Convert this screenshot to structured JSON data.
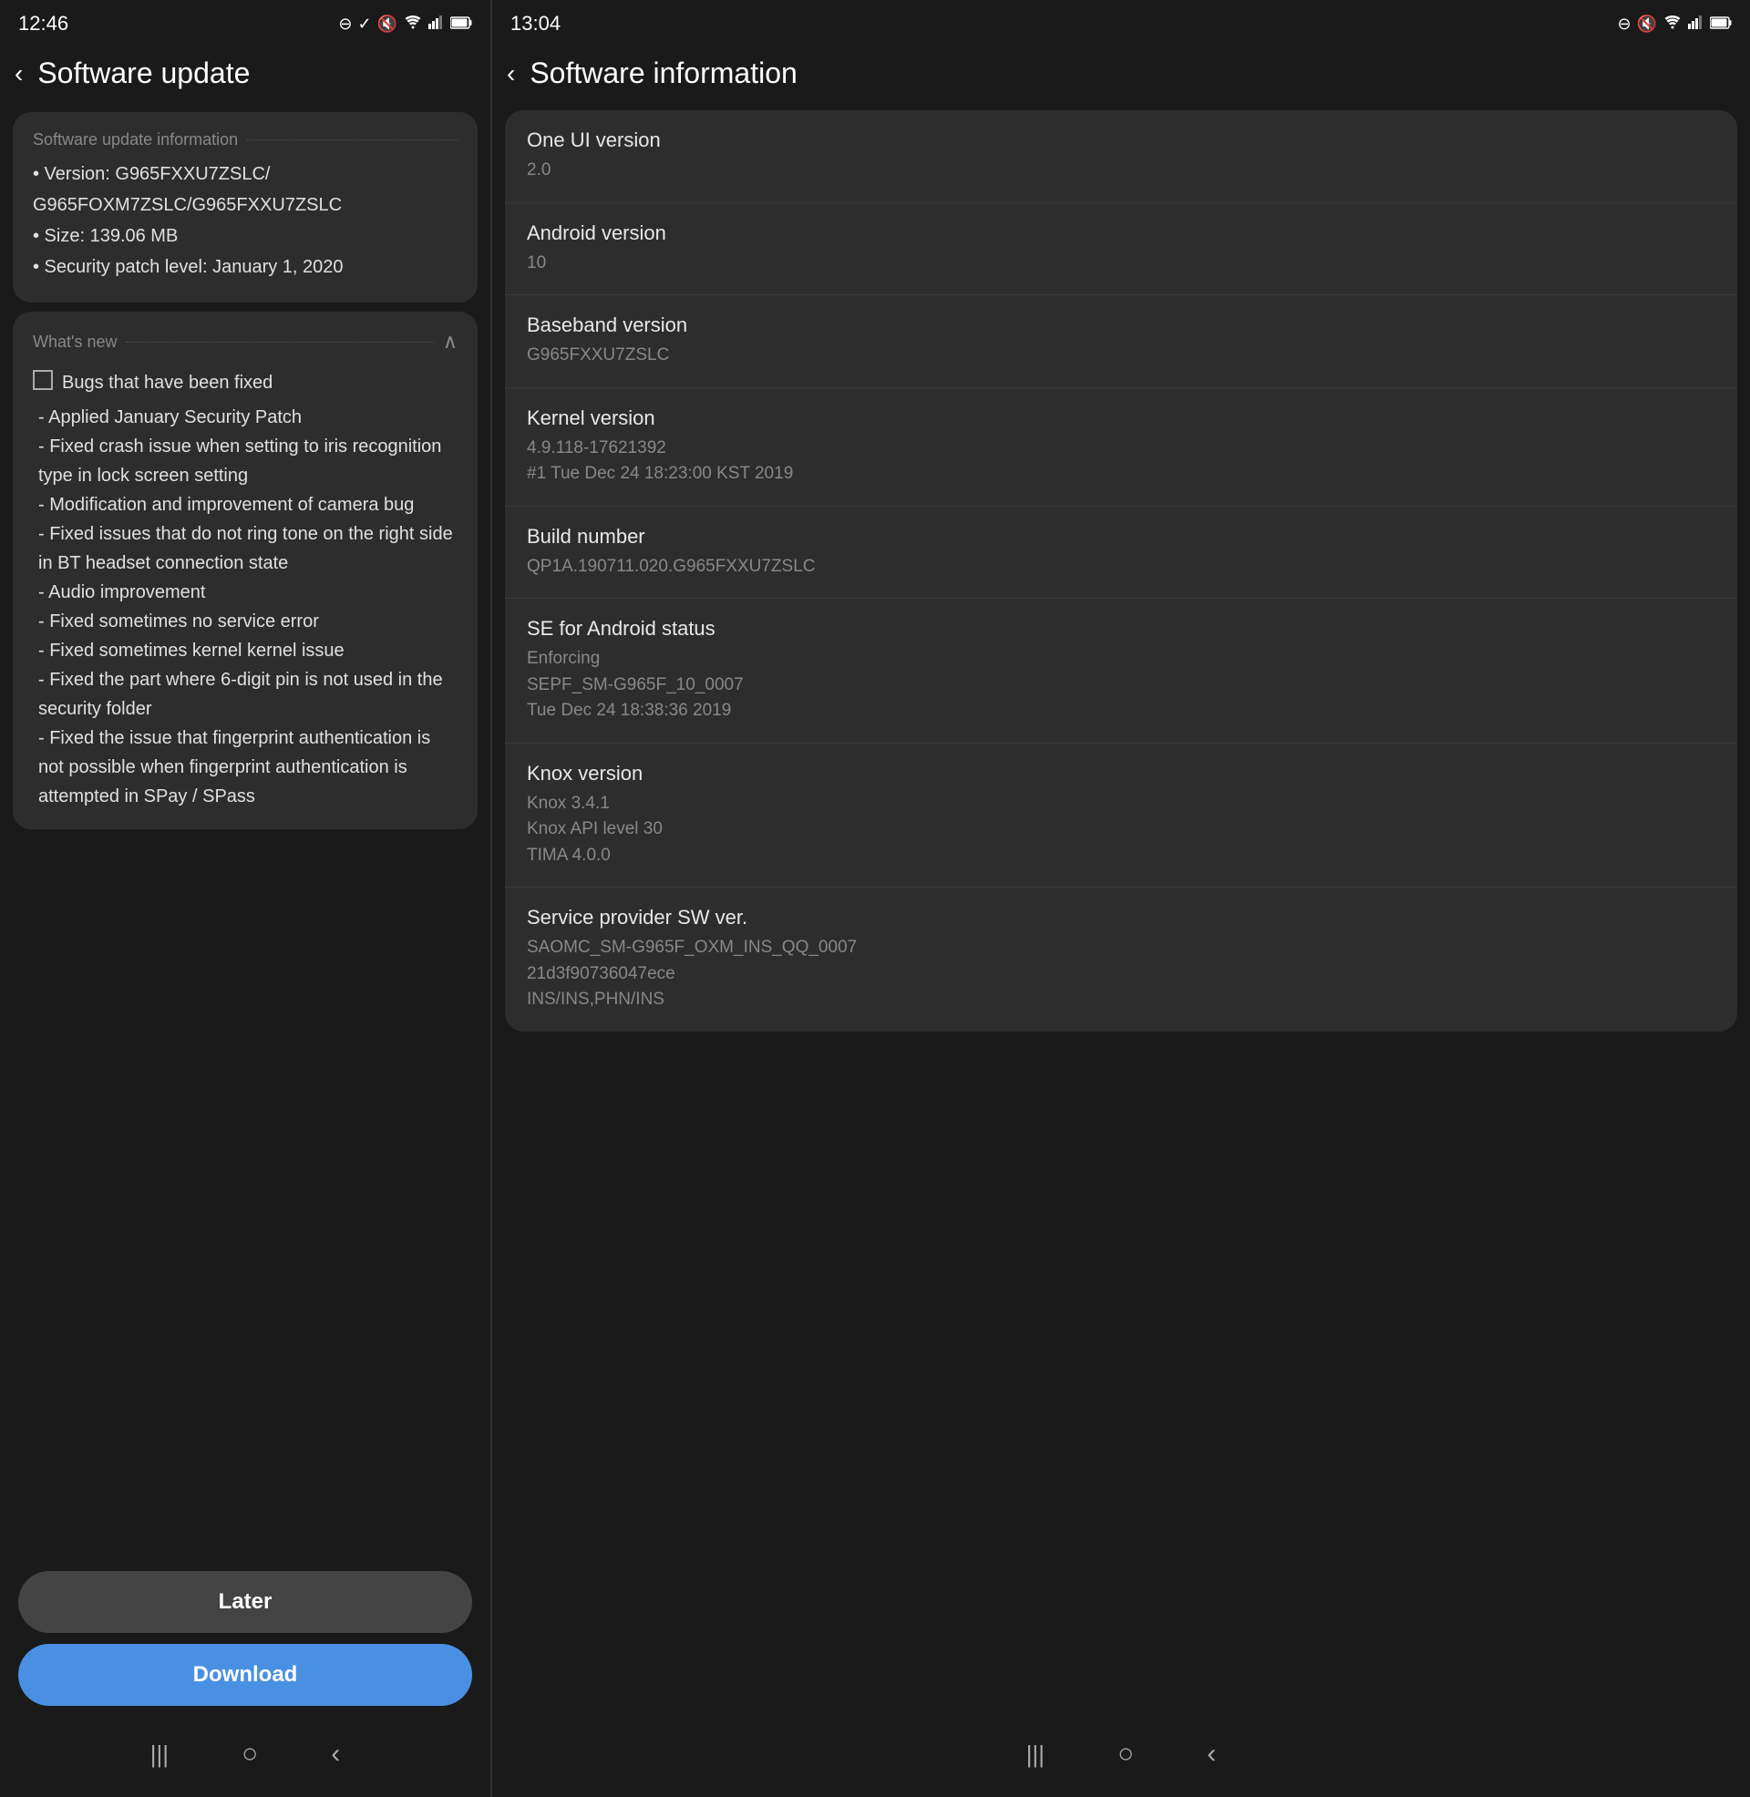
{
  "left": {
    "statusBar": {
      "time": "12:46",
      "icons": [
        "⊖",
        "✓",
        "🔇",
        "WiFi",
        "📶",
        "🔋"
      ]
    },
    "header": {
      "backArrow": "‹",
      "title": "Software update"
    },
    "updateInfo": {
      "sectionLabel": "Software update information",
      "version": "• Version: G965FXXU7ZSLC/",
      "versionCont": "  G965FOXM7ZSLC/G965FXXU7ZSLC",
      "size": "• Size: 139.06 MB",
      "securityPatch": "• Security patch level: January 1, 2020"
    },
    "whatsNew": {
      "title": "What's new",
      "checkboxLabel": "Bugs that have been fixed",
      "items": [
        "- Applied January Security Patch",
        "- Fixed crash issue when setting to iris recognition type in lock screen setting",
        "- Modification and improvement of camera bug",
        "- Fixed issues that do not ring tone on the right side in BT headset connection state",
        "- Audio improvement",
        "- Fixed sometimes no service error",
        "- Fixed sometimes kernel kernel issue",
        "- Fixed the part where 6-digit pin is not used in the security folder",
        "- Fixed the issue that fingerprint authentication is not possible when fingerprint authentication is attempted in SPay / SPass"
      ]
    },
    "buttons": {
      "later": "Later",
      "download": "Download"
    },
    "navBar": {
      "menu": "|||",
      "home": "○",
      "back": "‹"
    }
  },
  "right": {
    "statusBar": {
      "time": "13:04",
      "icons": [
        "⊖",
        "🔇",
        "WiFi",
        "📶",
        "🔋"
      ]
    },
    "header": {
      "backArrow": "‹",
      "title": "Software information"
    },
    "infoItems": [
      {
        "label": "One UI version",
        "value": "2.0"
      },
      {
        "label": "Android version",
        "value": "10"
      },
      {
        "label": "Baseband version",
        "value": "G965FXXU7ZSLC"
      },
      {
        "label": "Kernel version",
        "value": "4.9.118-17621392\n#1 Tue Dec 24 18:23:00 KST 2019"
      },
      {
        "label": "Build number",
        "value": "QP1A.190711.020.G965FXXU7ZSLC"
      },
      {
        "label": "SE for Android status",
        "value": "Enforcing\nSEPF_SM-G965F_10_0007\nTue Dec 24 18:38:36 2019"
      },
      {
        "label": "Knox version",
        "value": "Knox 3.4.1\nKnox API level 30\nTIMA 4.0.0"
      },
      {
        "label": "Service provider SW ver.",
        "value": "SAOMC_SM-G965F_OXM_INS_QQ_0007\n21d3f90736047ece\nINS/INS,PHN/INS"
      }
    ],
    "navBar": {
      "menu": "|||",
      "home": "○",
      "back": "‹"
    }
  }
}
